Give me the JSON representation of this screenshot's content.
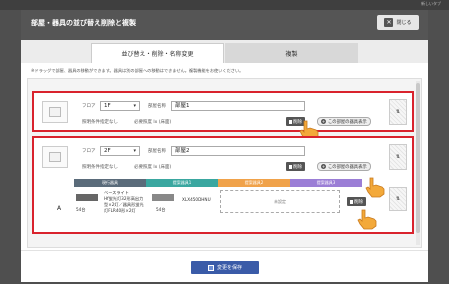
{
  "backdrop": {
    "corner_text": "新しいタブ"
  },
  "modal": {
    "title": "部屋・器具の並び替え削除と複製",
    "close_label": "閉じる"
  },
  "tabs": [
    {
      "label": "並び替え・削除・名称変更"
    },
    {
      "label": "複製"
    }
  ],
  "notice": "※ドラッグで部屋、器具の移動ができます。器具は別の部屋への移動はできません。複製機能をお使いください。",
  "rooms": [
    {
      "floor_label": "フロア",
      "floor_value": "1F",
      "room_name_label": "部屋名称",
      "room_name_value": "部屋1",
      "lighting_condition": "照明条件指定なし",
      "illuminance": "必要照度 lx (床面)",
      "delete_label": "削除",
      "add_label": "この部屋の器具表示"
    },
    {
      "floor_label": "フロア",
      "floor_value": "2F",
      "room_name_label": "部屋名称",
      "room_name_value": "部屋2",
      "lighting_condition": "照明条件指定なし",
      "illuminance": "必要照度 lx (床面)",
      "delete_label": "削除",
      "add_label": "この部屋の器具表示",
      "columns": [
        "現行器具",
        "提案器具1",
        "提案器具2",
        "提案器具3"
      ],
      "column_colors": [
        "#5a6b7a",
        "#3aa7a0",
        "#f0a24a",
        "#9b7ed6"
      ],
      "product": {
        "letter": "A",
        "count_1": "54台",
        "desc": "ベースライト\nHf蛍光灯32形高出力\n型×2灯／器具形蛍光\n灯FLR40形×2灯",
        "count_2": "54台",
        "model": "XLX450DHNU",
        "unset": "未設定",
        "delete_label": "削除"
      }
    }
  ],
  "footer": {
    "save_label": "変更を保存"
  }
}
